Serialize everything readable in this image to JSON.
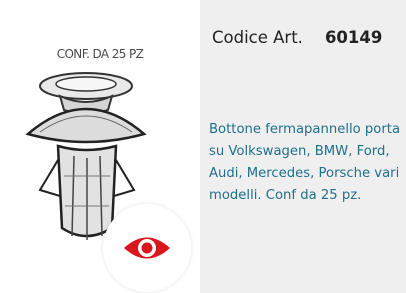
{
  "product": {
    "pack_label": "CONF. DA 25 PZ",
    "code_label": "Codice Art.",
    "code_value": "60149",
    "description": "Bottone fermapannello porta su Volkswagen, BMW, Ford, Audi, Mercedes, Porsche vari modelli. Conf da 25 pz."
  },
  "icons": {
    "view": "eye-icon"
  },
  "colors": {
    "accent_red": "#d7171f",
    "description_text": "#1f6f8b",
    "panel_background": "#efefef"
  }
}
